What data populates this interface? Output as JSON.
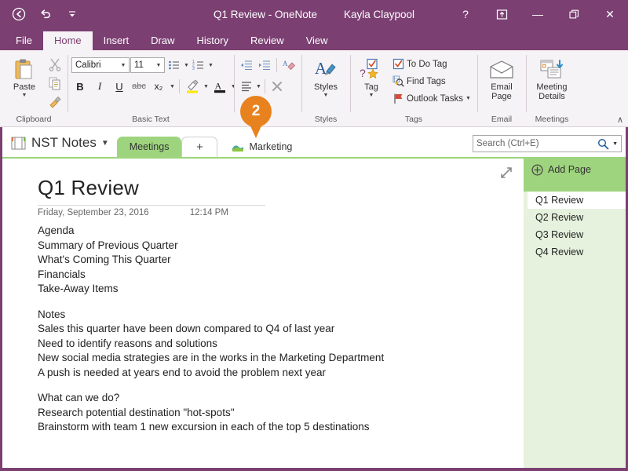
{
  "titlebar": {
    "doc_title": "Q1 Review - OneNote",
    "user_name": "Kayla Claypool",
    "back_icon": "back-circle-icon",
    "undo_icon": "undo-icon",
    "qat_more_icon": "quick-access-dropdown-icon",
    "help_label": "?",
    "ribbon_options_icon": "ribbon-display-options-icon",
    "minimize_label": "—",
    "restore_label": "❐",
    "close_label": "✕",
    "accent_color": "#7b3f72"
  },
  "ribbon": {
    "tabs": [
      {
        "label": "File",
        "active": false
      },
      {
        "label": "Home",
        "active": true
      },
      {
        "label": "Insert",
        "active": false
      },
      {
        "label": "Draw",
        "active": false
      },
      {
        "label": "History",
        "active": false
      },
      {
        "label": "Review",
        "active": false
      },
      {
        "label": "View",
        "active": false
      }
    ],
    "clipboard": {
      "group_label": "Clipboard",
      "paste_label": "Paste",
      "cut_label": "Cut",
      "copy_label": "Copy",
      "format_painter_label": "Format Painter"
    },
    "basic_text": {
      "group_label": "Basic Text",
      "font_name": "Calibri",
      "font_size": "11",
      "bold_label": "B",
      "italic_label": "I",
      "underline_label": "U",
      "strikethrough_label": "abc",
      "subscript_label": "x₂",
      "highlight_label": "Text Highlight Color",
      "font_color_label": "Font Color",
      "bullets_label": "Bullets",
      "numbering_label": "Numbering",
      "decrease_indent_label": "Decrease Indent",
      "increase_indent_label": "Increase Indent",
      "align_label": "Paragraph Alignment",
      "styles_clear_label": "Clear Formatting"
    },
    "styles": {
      "group_label": "Styles",
      "button_label": "Styles"
    },
    "tags": {
      "group_label": "Tags",
      "tag_button_label": "Tag",
      "todo_tag_label": "To Do Tag",
      "find_tags_label": "Find Tags",
      "outlook_tasks_label": "Outlook Tasks"
    },
    "email": {
      "group_label": "Email",
      "email_page_label": "Email\nPage",
      "email_page_line1": "Email",
      "email_page_line2": "Page"
    },
    "meetings": {
      "group_label": "Meetings",
      "meeting_details_line1": "Meeting",
      "meeting_details_line2": "Details"
    },
    "collapse_label": "∧"
  },
  "callout": {
    "number": "2"
  },
  "section_bar": {
    "notebook_name": "NST Notes",
    "notebook_icon": "notebook-icon",
    "notebook_caret": "▼",
    "tabs": [
      {
        "label": "Meetings",
        "active": true
      }
    ],
    "add_section_label": "+",
    "section_group": {
      "label": "Marketing",
      "icon": "section-group-icon"
    }
  },
  "search": {
    "placeholder": "Search (Ctrl+E)",
    "value": "",
    "icon": "search-icon",
    "caret": "▼"
  },
  "page": {
    "expand_icon": "expand-page-icon",
    "title": "Q1 Review",
    "date": "Friday, September 23, 2016",
    "time": "12:14 PM",
    "blocks": [
      {
        "lines": [
          "Agenda",
          "Summary of Previous Quarter",
          "What's Coming This Quarter",
          "Financials",
          "Take-Away Items"
        ]
      },
      {
        "lines": [
          "Notes",
          "Sales this quarter have been down compared to Q4 of last year",
          "Need to identify reasons and solutions",
          "New social media strategies are in the works in the Marketing Department",
          "A push is needed at years end to avoid the problem next year"
        ]
      },
      {
        "lines": [
          "What can we do?",
          "Research potential destination \"hot-spots\"",
          "Brainstorm with team 1 new excursion in each of the top 5 destinations"
        ]
      }
    ]
  },
  "page_list": {
    "add_page_label": "Add Page",
    "add_page_icon": "add-page-icon",
    "pages": [
      {
        "label": "Q1 Review",
        "active": true
      },
      {
        "label": "Q2 Review",
        "active": false
      },
      {
        "label": "Q3 Review",
        "active": false
      },
      {
        "label": "Q4 Review",
        "active": false
      }
    ]
  }
}
